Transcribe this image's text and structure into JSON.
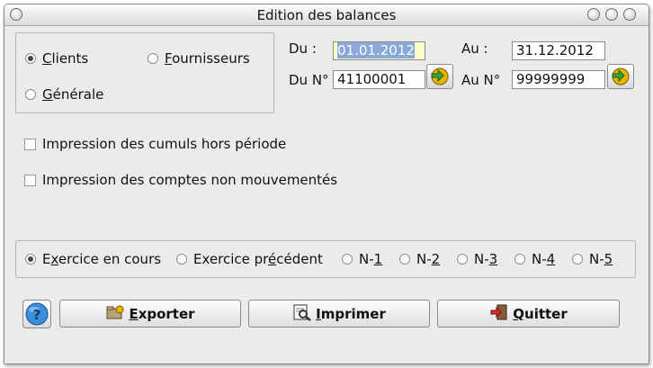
{
  "window": {
    "title": "Edition des balances",
    "controls": [
      "minimize",
      "maximize",
      "close"
    ]
  },
  "type_group": {
    "options": [
      {
        "label": "Clients",
        "mnemonic": "C",
        "selected": true
      },
      {
        "label": "Fournisseurs",
        "mnemonic": "F",
        "selected": false
      },
      {
        "label": "Générale",
        "mnemonic": "G",
        "selected": false
      }
    ]
  },
  "range": {
    "du_label": "Du :",
    "au_label": "Au :",
    "du_num_label": "Du N°",
    "au_num_label": "Au N°",
    "du_value": "01.01.2012",
    "au_value": "31.12.2012",
    "du_num_value": "41100001",
    "au_num_value": "99999999",
    "lookup_icon": "arrow-right-gold-icon"
  },
  "options": {
    "cumuls_label": "Impression des cumuls hors période",
    "cumuls_checked": false,
    "non_mouvementes_label": "Impression des comptes non mouvementés",
    "non_mouvementes_checked": false
  },
  "period_group": {
    "options": [
      {
        "label": "Exercice en cours",
        "selected": true
      },
      {
        "label": "Exercice précédent",
        "selected": false
      },
      {
        "label": "N-1",
        "selected": false
      },
      {
        "label": "N-2",
        "selected": false
      },
      {
        "label": "N-3",
        "selected": false
      },
      {
        "label": "N-4",
        "selected": false
      },
      {
        "label": "N-5",
        "selected": false
      }
    ]
  },
  "buttons": {
    "help_icon": "help-globe-icon",
    "export_label": "Exporter",
    "print_label": "Imprimer",
    "quit_label": "Quitter"
  },
  "colors": {
    "window_bg": "#ebebe9",
    "selection": "#8aa8d8",
    "focused_field": "#fffbc8",
    "lookup_icon_gold": "#e8b400"
  }
}
